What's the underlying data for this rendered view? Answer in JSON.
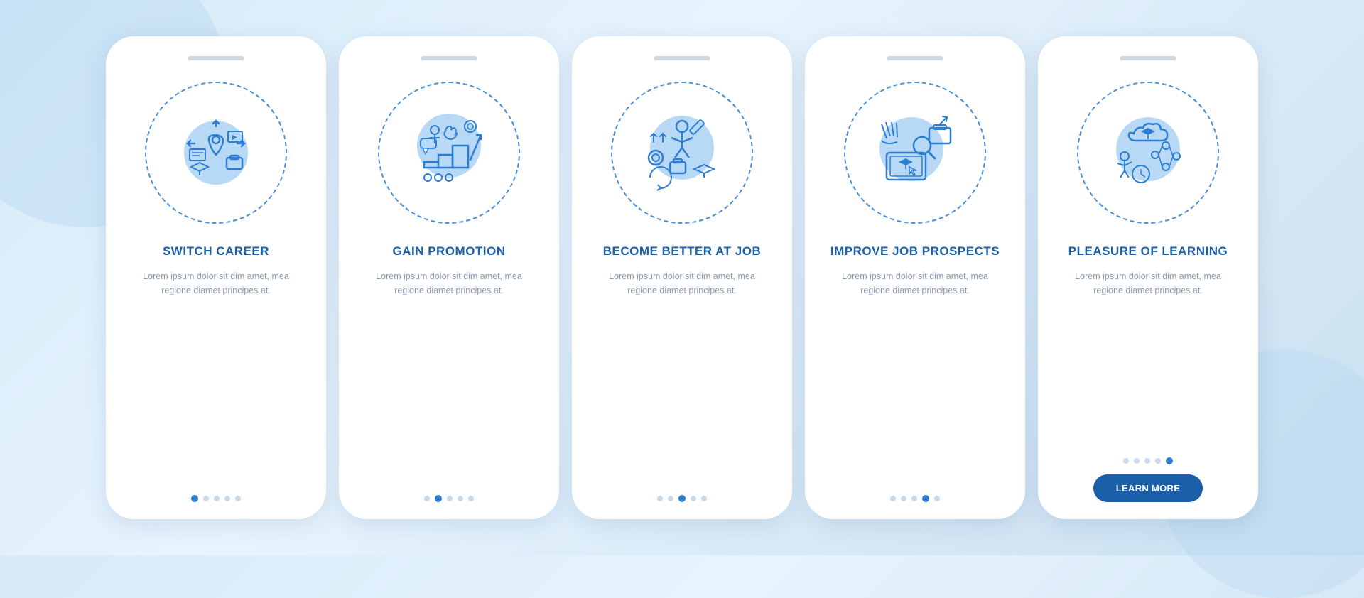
{
  "cards": [
    {
      "id": "switch-career",
      "title": "SWITCH CAREER",
      "description": "Lorem ipsum dolor sit dim amet, mea regione diamet principes at.",
      "dots": [
        true,
        false,
        false,
        false,
        false
      ],
      "active_dot": 0,
      "show_button": false,
      "button_label": ""
    },
    {
      "id": "gain-promotion",
      "title": "GAIN PROMOTION",
      "description": "Lorem ipsum dolor sit dim amet, mea regione diamet principes at.",
      "dots": [
        false,
        true,
        false,
        false,
        false
      ],
      "active_dot": 1,
      "show_button": false,
      "button_label": ""
    },
    {
      "id": "become-better",
      "title": "BECOME BETTER AT JOB",
      "description": "Lorem ipsum dolor sit dim amet, mea regione diamet principes at.",
      "dots": [
        false,
        false,
        true,
        false,
        false
      ],
      "active_dot": 2,
      "show_button": false,
      "button_label": ""
    },
    {
      "id": "improve-prospects",
      "title": "IMPROVE JOB PROSPECTS",
      "description": "Lorem ipsum dolor sit dim amet, mea regione diamet principes at.",
      "dots": [
        false,
        false,
        false,
        true,
        false
      ],
      "active_dot": 3,
      "show_button": false,
      "button_label": ""
    },
    {
      "id": "pleasure-learning",
      "title": "PLEASURE OF LEARNING",
      "description": "Lorem ipsum dolor sit dim amet, mea regione diamet principes at.",
      "dots": [
        false,
        false,
        false,
        false,
        true
      ],
      "active_dot": 4,
      "show_button": true,
      "button_label": "LEARN MORE"
    }
  ]
}
